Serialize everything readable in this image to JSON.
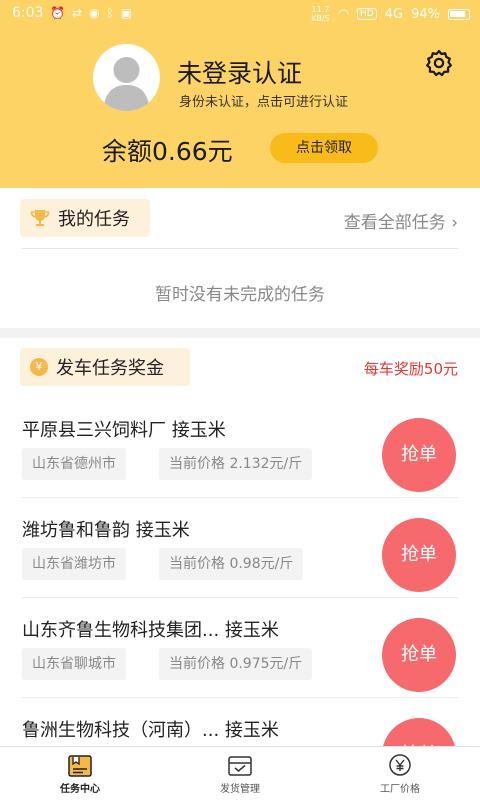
{
  "status_bar": {
    "time": "6:03",
    "speed_top": "11.7",
    "speed_bottom": "KB/S",
    "hd": "HD",
    "network": "4G",
    "battery": "94%"
  },
  "profile": {
    "name": "未登录认证",
    "subtitle": "身份未认证，点击可进行认证",
    "balance": "余额0.66元",
    "claim_label": "点击领取"
  },
  "my_tasks": {
    "title": "我的任务",
    "view_all": "查看全部任务 ›",
    "empty": "暂时没有未完成的任务"
  },
  "reward": {
    "title": "发车任务奖金",
    "note": "每车奖励50元",
    "coin_glyph": "¥"
  },
  "orders": [
    {
      "title": "平原县三兴饲料厂  接玉米",
      "location": "山东省德州市",
      "price": "当前价格 2.132元/斤",
      "action": "抢单"
    },
    {
      "title": "潍坊鲁和鲁韵  接玉米",
      "location": "山东省潍坊市",
      "price": "当前价格 0.98元/斤",
      "action": "抢单"
    },
    {
      "title": "山东齐鲁生物科技集团...  接玉米",
      "location": "山东省聊城市",
      "price": "当前价格 0.975元/斤",
      "action": "抢单"
    },
    {
      "title": "鲁洲生物科技（河南）...  接玉米",
      "location": "",
      "price": "",
      "action": "抢单"
    }
  ],
  "nav": [
    {
      "label": "任务中心",
      "icon": "task-center-icon",
      "active": true
    },
    {
      "label": "发货管理",
      "icon": "shipping-icon",
      "active": false
    },
    {
      "label": "工厂价格",
      "icon": "price-icon",
      "active": false
    }
  ],
  "colors": {
    "header": "#fdd365",
    "claim_button": "#f9bb1a",
    "grab_button": "#f6696c",
    "note_red": "#e53935"
  }
}
